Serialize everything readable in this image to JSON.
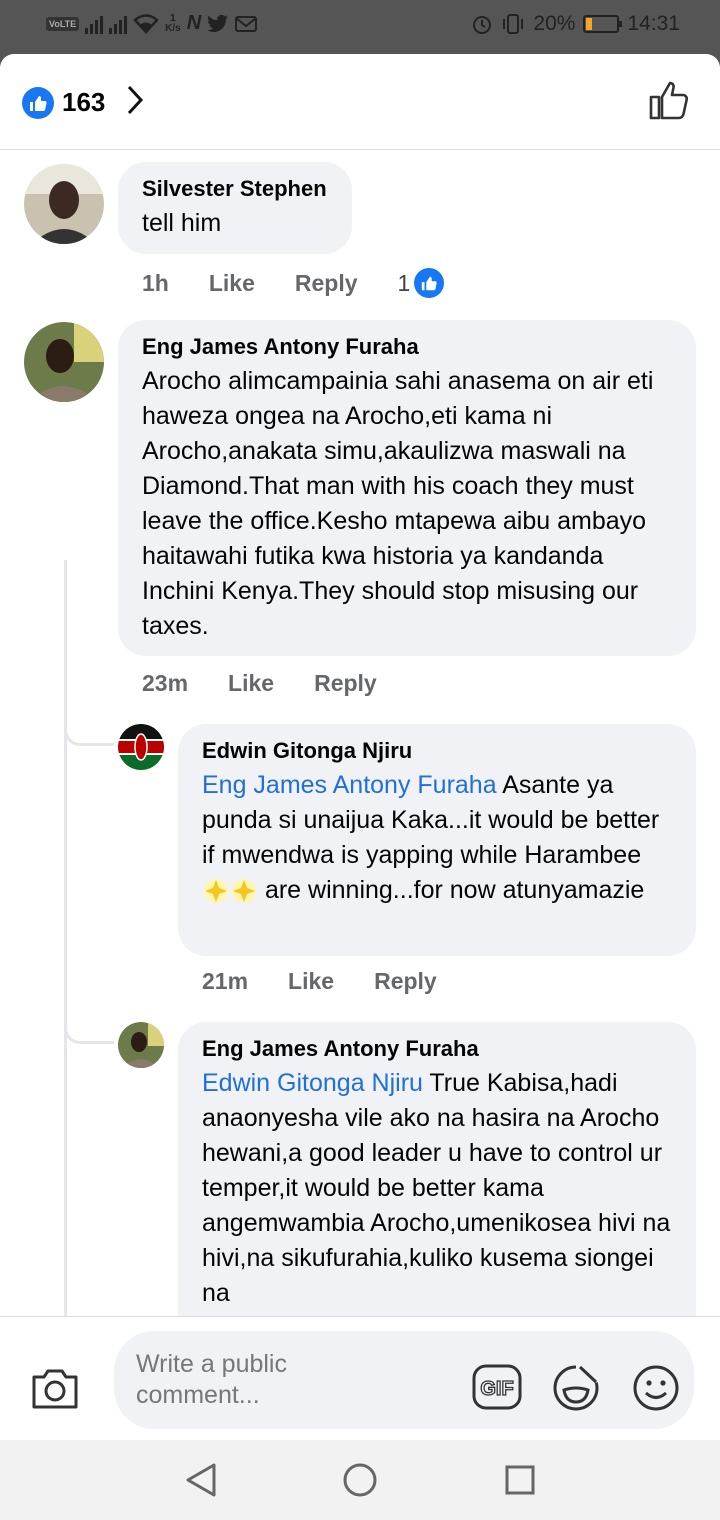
{
  "status_bar": {
    "network_speed_value": "1",
    "network_speed_unit": "K/s",
    "notifications": [
      "N",
      "twitter-icon",
      "gmail-icon"
    ],
    "battery": "20%",
    "battery_level": 0.2,
    "time": "14:31"
  },
  "reactions": {
    "count": "163"
  },
  "comments": [
    {
      "author": "Silvester Stephen",
      "text": "tell him",
      "time": "1h",
      "like": "Like",
      "reply": "Reply",
      "reaction_count": "1"
    },
    {
      "author": "Eng James Antony Furaha",
      "text": "Arocho alimcampainia sahi anasema on air eti haweza ongea na Arocho,eti kama ni Arocho,anakata simu,akaulizwa maswali na Diamond.That man with his coach they must leave the office.Kesho mtapewa aibu ambayo haitawahi futika kwa historia ya kandanda Inchini Kenya.They should stop misusing our taxes.",
      "time": "23m",
      "like": "Like",
      "reply": "Reply"
    },
    {
      "author": "Edwin Gitonga Njiru",
      "mention": "Eng James Antony Furaha",
      "text_a": " Asante ya punda si unaijua Kaka...it would be better if mwendwa is yapping while Harambee ",
      "text_b": " are winning...for now atunyamazie",
      "time": "21m",
      "like": "Like",
      "reply": "Reply"
    },
    {
      "author": "Eng James Antony Furaha",
      "mention": "Edwin Gitonga Njiru",
      "text": " True Kabisa,hadi anaonyesha vile ako na hasira na Arocho hewani,a good leader u have to control ur temper,it would be better kama angemwambia Arocho,umenikosea hivi na hivi,na sikufurahia,kuliko kusema siongei na"
    }
  ],
  "composer": {
    "placeholder": "Write a public comment..."
  },
  "colors": {
    "accent": "#1877f2",
    "mention": "#216fdb",
    "bubble": "#f0f2f5",
    "meta": "#65676b"
  }
}
